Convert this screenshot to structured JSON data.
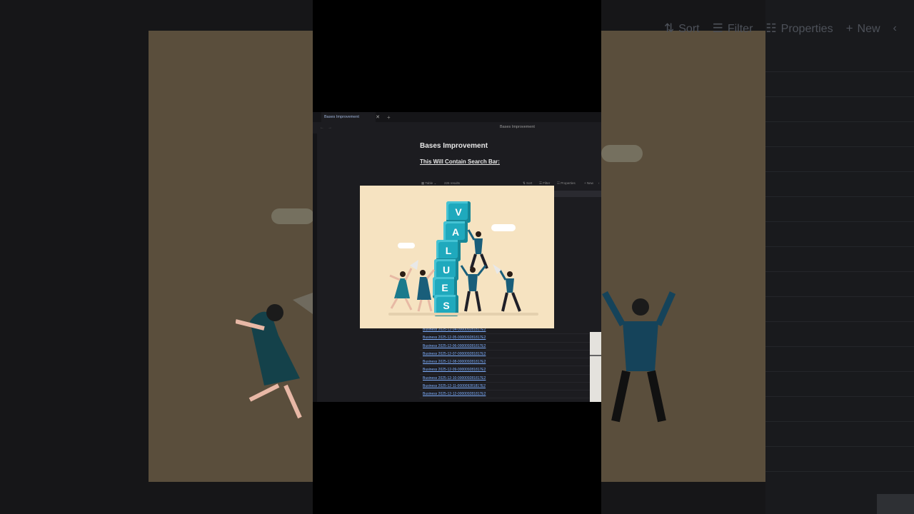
{
  "background": {
    "toolbar": {
      "sort_label": "Sort",
      "filter_label": "Filter",
      "properties_label": "Properties",
      "new_label": "New"
    },
    "illustration_bg_color": "#5a4e3c"
  },
  "app": {
    "tab": {
      "title": "Bases Improvement",
      "close_icon": "close-icon",
      "add_icon": "plus-icon"
    },
    "nav": {
      "title": "Bases Improvement",
      "back_icon": "arrow-left-icon",
      "forward_icon": "arrow-right-icon"
    },
    "document": {
      "title": "Bases Improvement",
      "heading": "This Will Contain Search Bar:"
    },
    "table_toolbar": {
      "view_label": "Table",
      "results_label": "226 results",
      "sort_label": "Sort",
      "filter_label": "Filter",
      "properties_label": "Properties",
      "new_label": "New"
    },
    "rows": [
      "Business 2025-12-04-000009281817E2",
      "Business 2025-12-05-000009281817E2",
      "Business 2025-12-06-000009281817E2",
      "Business 2025-12-07-000009281817E2",
      "Business 2025-12-08-000009281817E2",
      "Business 2025-12-09-000009281817E2",
      "Business 2025-12-10-000009281817E2",
      "Business 2025-12-11-000009281817E2",
      "Business 2025-12-12-000009281817E2"
    ],
    "link_color": "#7fb0ff"
  },
  "overlay": {
    "letters": [
      "V",
      "A",
      "L",
      "U",
      "E",
      "S"
    ],
    "card_color": "#f6e3c1",
    "cube_color": "#1fa9bd"
  }
}
